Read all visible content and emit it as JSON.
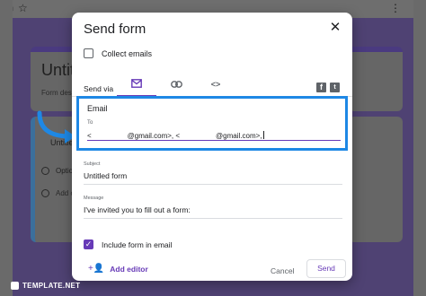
{
  "background": {
    "form_title": "Untit",
    "form_desc": "Form des",
    "question_title": "Untitled",
    "option1": "Optio",
    "option2": "Add o"
  },
  "dialog": {
    "title": "Send form",
    "collect_emails_label": "Collect emails",
    "send_via_label": "Send via",
    "email_section_title": "Email",
    "to_label": "To",
    "to_value": "<                  @gmail.com>, <                  @gmail.com>,",
    "subject_label": "Subject",
    "subject_value": "Untitled form",
    "message_label": "Message",
    "message_value": "I've invited you to fill out a form:",
    "include_form_label": "Include form in email",
    "add_editor_label": "Add editor",
    "cancel_label": "Cancel",
    "send_label": "Send"
  },
  "watermark": {
    "text": "TEMPLATE.NET"
  },
  "colors": {
    "accent": "#673ab7",
    "highlight": "#1e88e5"
  },
  "icons": [
    "close-icon",
    "email-icon",
    "link-icon",
    "embed-icon",
    "facebook-icon",
    "twitter-icon",
    "add-person-icon"
  ]
}
